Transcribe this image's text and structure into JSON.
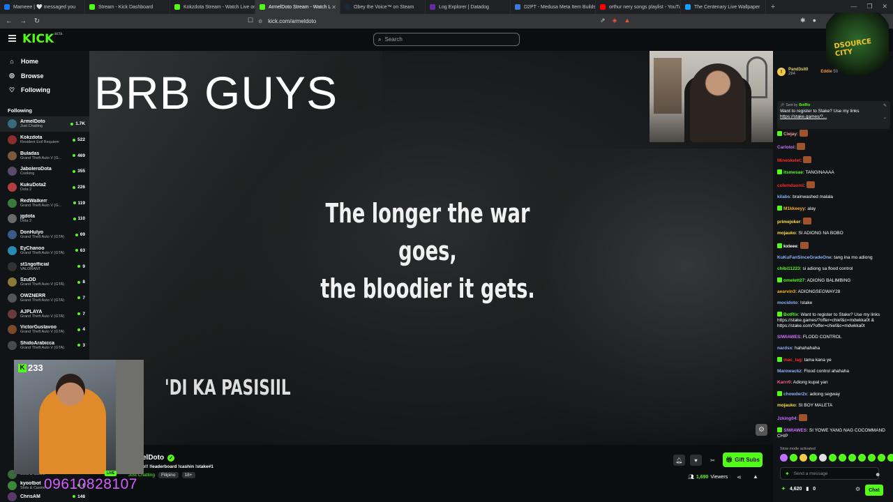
{
  "browser": {
    "tabs": [
      {
        "title": "Mameee | 🤍 messaged you",
        "color": "#1877f2"
      },
      {
        "title": "Stream - Kick Dashboard",
        "color": "#53fc18"
      },
      {
        "title": "Kokzdota Stream - Watch Live on Ki",
        "color": "#53fc18"
      },
      {
        "title": "ArmelDoto Stream - Watch L",
        "color": "#53fc18",
        "active": true
      },
      {
        "title": "Obey the Voice™ on Steam",
        "color": "#1b2838"
      },
      {
        "title": "Log Explorer | Datadog",
        "color": "#632ca6"
      },
      {
        "title": "D2PT - Medusa Meta Item Builds &",
        "color": "#3a7bd5"
      },
      {
        "title": "orthur nery songs playlist - YouTube",
        "color": "#ff0000"
      },
      {
        "title": "The Centenary Live Wallpaper",
        "color": "#1a9fff"
      }
    ],
    "url": "kick.com/armeldoto"
  },
  "kick": {
    "logo": "KICK",
    "logo_sup": "BETA",
    "search_placeholder": "Search"
  },
  "sidebar": {
    "nav": [
      {
        "label": "Home",
        "icon": "home-icon",
        "glyph": "⌂"
      },
      {
        "label": "Browse",
        "icon": "compass-icon",
        "glyph": "◎"
      },
      {
        "label": "Following",
        "icon": "heart-icon",
        "glyph": "♡"
      }
    ],
    "following_label": "Following",
    "channels": [
      {
        "name": "ArmelDoto",
        "category": "Just Chatting",
        "viewers": "1.7K",
        "color": "#3a6b7a",
        "active": true
      },
      {
        "name": "Kokzdota",
        "category": "Resident Evil Requiem",
        "viewers": "522",
        "color": "#8b2e2e"
      },
      {
        "name": "Buladas",
        "category": "Grand Theft Auto V (G...",
        "viewers": "469",
        "color": "#7a5a3a"
      },
      {
        "name": "JaboleroDota",
        "category": "Cooking",
        "viewers": "355",
        "color": "#5a4a6a"
      },
      {
        "name": "KukuDota2",
        "category": "Dota 2",
        "viewers": "226",
        "color": "#b04040"
      },
      {
        "name": "RedWalkerr",
        "category": "Grand Theft Auto V (G...",
        "viewers": "119",
        "color": "#3a7a3a"
      },
      {
        "name": "jgdota",
        "category": "Dota 2",
        "viewers": "110",
        "color": "#6a6a6a"
      },
      {
        "name": "DonHulyo",
        "category": "Grand Theft Auto V (GTA)",
        "viewers": "69",
        "color": "#3a5a8a"
      },
      {
        "name": "EyChanoo",
        "category": "Grand Theft Auto V (GTA)",
        "viewers": "63",
        "color": "#2a8ab0"
      },
      {
        "name": "st1ngofficial",
        "category": "VALORANT",
        "viewers": "9",
        "color": "#333"
      },
      {
        "name": "SzuDD",
        "category": "Grand Theft Auto V (GTA)",
        "viewers": "8",
        "color": "#8a7a3a"
      },
      {
        "name": "OWZNERR",
        "category": "Grand Theft Auto V (GTA)",
        "viewers": "7",
        "color": "#555"
      },
      {
        "name": "AJPLAYA",
        "category": "Grand Theft Auto V (GTA)",
        "viewers": "7",
        "color": "#6a3a3a"
      },
      {
        "name": "VictorGustavoo",
        "category": "Grand Theft Auto V (GTA)",
        "viewers": "4",
        "color": "#7a4a2a"
      },
      {
        "name": "ShidoArabicca",
        "category": "Grand Theft Auto V (GTA)",
        "viewers": "3",
        "color": "#4a4a4a"
      }
    ],
    "bottom_channels": [
      {
        "name": "",
        "category": "Slots & Casino",
        "viewers": "",
        "color": "#3a6a3a"
      },
      {
        "name": "kyootbot",
        "category": "Slots & Casino",
        "viewers": "0",
        "color": "#3a8a3a"
      },
      {
        "name": "ChrisAM",
        "category": "",
        "viewers": "148",
        "color": "#5a3a6a"
      }
    ]
  },
  "video": {
    "brb_text": "BRB GUYS",
    "quote_line1": "The longer the war goes,",
    "quote_line2": "the bloodier it gets.",
    "overlay_text": "'DI KA PASISIIL",
    "pip_count": "233",
    "phone_number": "09610828107",
    "live_label": "LIVE"
  },
  "stream": {
    "name": "elDoto",
    "title": "o!! !leaderboard !cashin !stake#1",
    "category": "Just Chatting",
    "tags": [
      "Filipino",
      "18+"
    ],
    "gift_subs_label": "Gift Subs",
    "viewers_count": "1,690",
    "viewers_label": "Viewers"
  },
  "chat": {
    "gift_user": "Pand3sit0",
    "gift_num": "284",
    "gift_user2": "Eddie",
    "gift_num2": "50",
    "pinned": {
      "sent_by": "Sent by",
      "bot": "BotRix",
      "text": "Want to register to Stake? Use my links",
      "link": "https://stake.games/?..."
    },
    "messages": [
      {
        "user": "Ciejay",
        "color": "#f0a0a0",
        "text": "",
        "emote": true
      },
      {
        "user": "Carlotoi",
        "color": "#d070ff",
        "text": "",
        "emote": true
      },
      {
        "user": "Mineskelet",
        "color": "#ff2a2a",
        "text": "",
        "emote": true
      },
      {
        "user": "itsmesae",
        "color": "#53fc18",
        "text": "TANGINAAAA"
      },
      {
        "user": "colemdaomi",
        "color": "#ff2a2a",
        "text": "",
        "emote": true
      },
      {
        "user": "kilabs",
        "color": "#8ab4ff",
        "text": "brainwashed malala"
      },
      {
        "user": "M1kkeeyy",
        "color": "#ffb020",
        "text": "alay"
      },
      {
        "user": "primejoker",
        "color": "#ffe14a",
        "text": "",
        "emote": true
      },
      {
        "user": "mojauko",
        "color": "#ffe14a",
        "text": "SI ADIONG NA BOBO"
      },
      {
        "user": "kxleee",
        "color": "#ffffff",
        "text": "",
        "emote": true
      },
      {
        "user": "KuKuFanSinceGradeOne",
        "color": "#8ab4ff",
        "text": "tang ina mo adiong"
      },
      {
        "user": "chibi11223",
        "color": "#53fc18",
        "text": "si adiong sa flood control"
      },
      {
        "user": "omelett27",
        "color": "#53fc18",
        "text": "ADIONG BALIMBING"
      },
      {
        "user": "aearvin3",
        "color": "#ffb020",
        "text": "ADIONGSEGWAY28"
      },
      {
        "user": "mocidoto",
        "color": "#8ab4ff",
        "text": "!stake"
      },
      {
        "user": "BotRix",
        "color": "#53fc18",
        "text": "Want to register to Stake? Use my links https://stake.games/?offer=chief&c=mdwkka0t & https://stake.com/?offer=chief&c=mdwkka0t"
      },
      {
        "user": "SIWIAWES",
        "color": "#d070ff",
        "text": "FLODD CONTROL"
      },
      {
        "user": "nardsx",
        "color": "#8ab4ff",
        "text": "hahahahaha"
      },
      {
        "user": "mac_lag",
        "color": "#ff2a2a",
        "text": "tama kana ye"
      },
      {
        "user": "Marowackz",
        "color": "#8ab4ff",
        "text": "Flood control ahahaha"
      },
      {
        "user": "Karrr0",
        "color": "#ff5a8a",
        "text": "Adiong kupal yan"
      },
      {
        "user": "chowder2x",
        "color": "#8ab4ff",
        "text": "adiong segway"
      },
      {
        "user": "mojauko",
        "color": "#ffe14a",
        "text": "SI BOY MALETA"
      },
      {
        "user": "Jzking04",
        "color": "#d070ff",
        "text": "",
        "emote": true
      },
      {
        "user": "SIWIAWES",
        "color": "#d070ff",
        "text": "SI YOWE YANG NAG COCOMMAND CHIP"
      }
    ],
    "slow_mode": "Slow mode activated",
    "input_placeholder": "Send a message",
    "points": "4,620",
    "zero": "0",
    "chat_label": "Chat"
  }
}
